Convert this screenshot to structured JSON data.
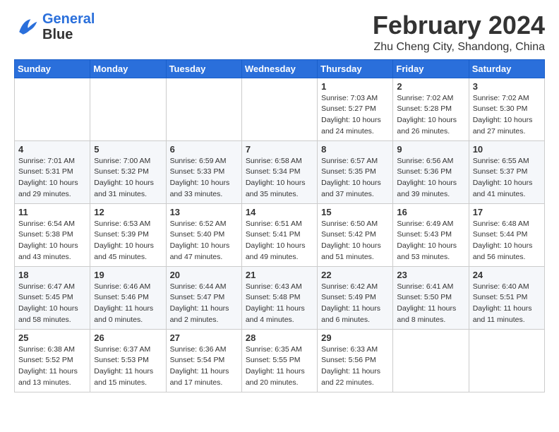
{
  "header": {
    "logo_line1": "General",
    "logo_line2": "Blue",
    "month_year": "February 2024",
    "location": "Zhu Cheng City, Shandong, China"
  },
  "weekdays": [
    "Sunday",
    "Monday",
    "Tuesday",
    "Wednesday",
    "Thursday",
    "Friday",
    "Saturday"
  ],
  "weeks": [
    [
      {
        "day": "",
        "info": ""
      },
      {
        "day": "",
        "info": ""
      },
      {
        "day": "",
        "info": ""
      },
      {
        "day": "",
        "info": ""
      },
      {
        "day": "1",
        "info": "Sunrise: 7:03 AM\nSunset: 5:27 PM\nDaylight: 10 hours\nand 24 minutes."
      },
      {
        "day": "2",
        "info": "Sunrise: 7:02 AM\nSunset: 5:28 PM\nDaylight: 10 hours\nand 26 minutes."
      },
      {
        "day": "3",
        "info": "Sunrise: 7:02 AM\nSunset: 5:30 PM\nDaylight: 10 hours\nand 27 minutes."
      }
    ],
    [
      {
        "day": "4",
        "info": "Sunrise: 7:01 AM\nSunset: 5:31 PM\nDaylight: 10 hours\nand 29 minutes."
      },
      {
        "day": "5",
        "info": "Sunrise: 7:00 AM\nSunset: 5:32 PM\nDaylight: 10 hours\nand 31 minutes."
      },
      {
        "day": "6",
        "info": "Sunrise: 6:59 AM\nSunset: 5:33 PM\nDaylight: 10 hours\nand 33 minutes."
      },
      {
        "day": "7",
        "info": "Sunrise: 6:58 AM\nSunset: 5:34 PM\nDaylight: 10 hours\nand 35 minutes."
      },
      {
        "day": "8",
        "info": "Sunrise: 6:57 AM\nSunset: 5:35 PM\nDaylight: 10 hours\nand 37 minutes."
      },
      {
        "day": "9",
        "info": "Sunrise: 6:56 AM\nSunset: 5:36 PM\nDaylight: 10 hours\nand 39 minutes."
      },
      {
        "day": "10",
        "info": "Sunrise: 6:55 AM\nSunset: 5:37 PM\nDaylight: 10 hours\nand 41 minutes."
      }
    ],
    [
      {
        "day": "11",
        "info": "Sunrise: 6:54 AM\nSunset: 5:38 PM\nDaylight: 10 hours\nand 43 minutes."
      },
      {
        "day": "12",
        "info": "Sunrise: 6:53 AM\nSunset: 5:39 PM\nDaylight: 10 hours\nand 45 minutes."
      },
      {
        "day": "13",
        "info": "Sunrise: 6:52 AM\nSunset: 5:40 PM\nDaylight: 10 hours\nand 47 minutes."
      },
      {
        "day": "14",
        "info": "Sunrise: 6:51 AM\nSunset: 5:41 PM\nDaylight: 10 hours\nand 49 minutes."
      },
      {
        "day": "15",
        "info": "Sunrise: 6:50 AM\nSunset: 5:42 PM\nDaylight: 10 hours\nand 51 minutes."
      },
      {
        "day": "16",
        "info": "Sunrise: 6:49 AM\nSunset: 5:43 PM\nDaylight: 10 hours\nand 53 minutes."
      },
      {
        "day": "17",
        "info": "Sunrise: 6:48 AM\nSunset: 5:44 PM\nDaylight: 10 hours\nand 56 minutes."
      }
    ],
    [
      {
        "day": "18",
        "info": "Sunrise: 6:47 AM\nSunset: 5:45 PM\nDaylight: 10 hours\nand 58 minutes."
      },
      {
        "day": "19",
        "info": "Sunrise: 6:46 AM\nSunset: 5:46 PM\nDaylight: 11 hours\nand 0 minutes."
      },
      {
        "day": "20",
        "info": "Sunrise: 6:44 AM\nSunset: 5:47 PM\nDaylight: 11 hours\nand 2 minutes."
      },
      {
        "day": "21",
        "info": "Sunrise: 6:43 AM\nSunset: 5:48 PM\nDaylight: 11 hours\nand 4 minutes."
      },
      {
        "day": "22",
        "info": "Sunrise: 6:42 AM\nSunset: 5:49 PM\nDaylight: 11 hours\nand 6 minutes."
      },
      {
        "day": "23",
        "info": "Sunrise: 6:41 AM\nSunset: 5:50 PM\nDaylight: 11 hours\nand 8 minutes."
      },
      {
        "day": "24",
        "info": "Sunrise: 6:40 AM\nSunset: 5:51 PM\nDaylight: 11 hours\nand 11 minutes."
      }
    ],
    [
      {
        "day": "25",
        "info": "Sunrise: 6:38 AM\nSunset: 5:52 PM\nDaylight: 11 hours\nand 13 minutes."
      },
      {
        "day": "26",
        "info": "Sunrise: 6:37 AM\nSunset: 5:53 PM\nDaylight: 11 hours\nand 15 minutes."
      },
      {
        "day": "27",
        "info": "Sunrise: 6:36 AM\nSunset: 5:54 PM\nDaylight: 11 hours\nand 17 minutes."
      },
      {
        "day": "28",
        "info": "Sunrise: 6:35 AM\nSunset: 5:55 PM\nDaylight: 11 hours\nand 20 minutes."
      },
      {
        "day": "29",
        "info": "Sunrise: 6:33 AM\nSunset: 5:56 PM\nDaylight: 11 hours\nand 22 minutes."
      },
      {
        "day": "",
        "info": ""
      },
      {
        "day": "",
        "info": ""
      }
    ]
  ]
}
